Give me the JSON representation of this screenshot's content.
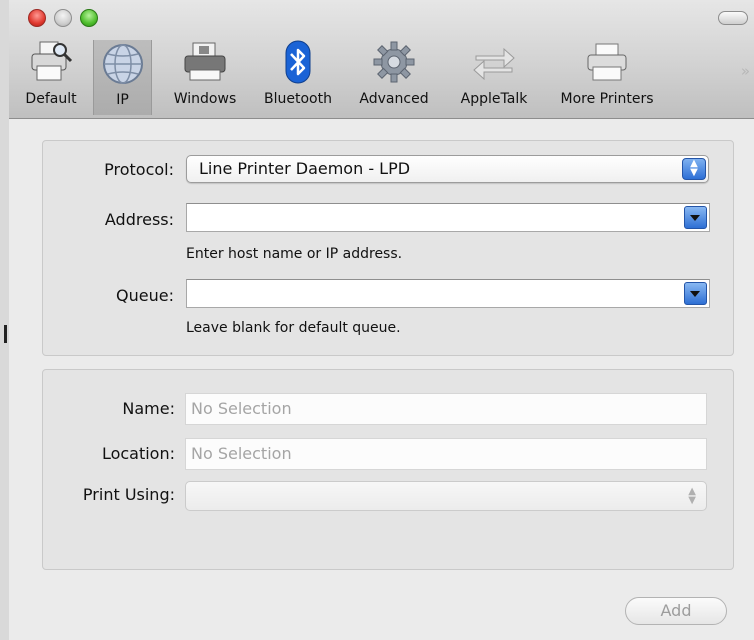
{
  "toolbar": {
    "items": [
      {
        "label": "Default",
        "icon": "default-printer-icon"
      },
      {
        "label": "IP",
        "icon": "globe-icon",
        "selected": true
      },
      {
        "label": "Windows",
        "icon": "windows-printer-icon"
      },
      {
        "label": "Bluetooth",
        "icon": "bluetooth-icon"
      },
      {
        "label": "Advanced",
        "icon": "gear-icon"
      },
      {
        "label": "AppleTalk",
        "icon": "appletalk-arrows-icon"
      },
      {
        "label": "More Printers",
        "icon": "printer-icon"
      }
    ],
    "overflow_glyph": "»"
  },
  "ip_group": {
    "protocol_label": "Protocol:",
    "protocol_value": "Line Printer Daemon - LPD",
    "address_label": "Address:",
    "address_value": "",
    "address_hint": "Enter host name or IP address.",
    "queue_label": "Queue:",
    "queue_value": "",
    "queue_hint": "Leave blank for default queue."
  },
  "info_group": {
    "name_label": "Name:",
    "name_placeholder": "No Selection",
    "location_label": "Location:",
    "location_placeholder": "No Selection",
    "print_using_label": "Print Using:",
    "print_using_value": ""
  },
  "add_button_label": "Add",
  "colors": {
    "accent_blue": "#2e6fd4",
    "close_red": "#e0392f",
    "zoom_green": "#4fbe2d"
  }
}
